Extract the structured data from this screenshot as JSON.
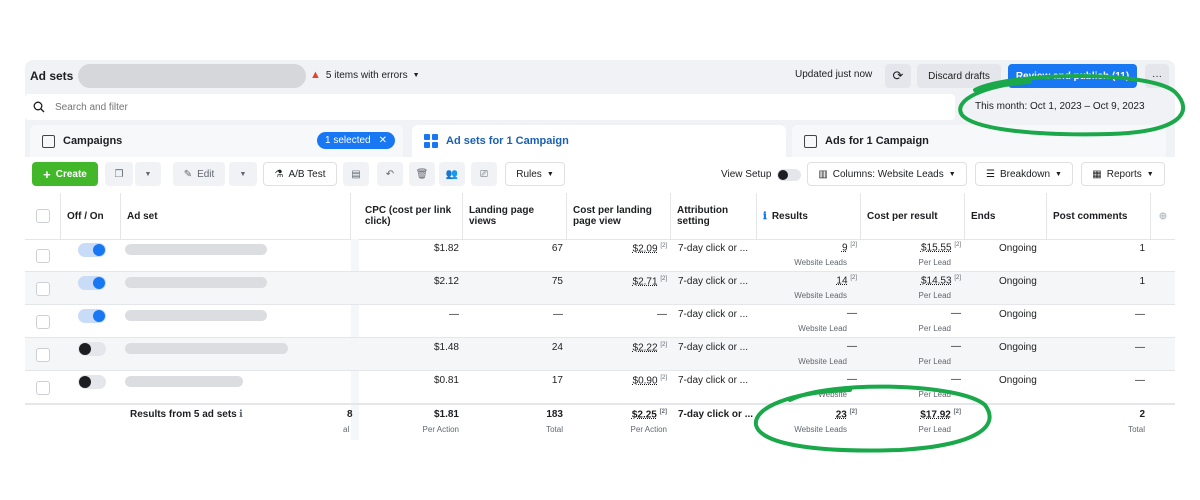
{
  "header": {
    "title": "Ad sets",
    "errors": "5 items with errors",
    "updated": "Updated just now",
    "discard": "Discard drafts",
    "publish": "Review and publish (11)",
    "more": "···"
  },
  "search": {
    "placeholder": "Search and filter"
  },
  "date_range": "This month: Oct 1, 2023 – Oct 9, 2023",
  "tabs": {
    "campaigns": "Campaigns",
    "selected": "1 selected",
    "adsets": "Ad sets for 1 Campaign",
    "ads": "Ads for 1 Campaign"
  },
  "toolbar": {
    "create": "Create",
    "edit": "Edit",
    "ab_test": "A/B Test",
    "rules": "Rules",
    "view_setup": "View Setup",
    "columns": "Columns: Website Leads",
    "breakdown": "Breakdown",
    "reports": "Reports"
  },
  "columns": {
    "off_on": "Off / On",
    "ad_set": "Ad set",
    "cpc": "CPC (cost per link click)",
    "lpv": "Landing page views",
    "cplpv": "Cost per landing page view",
    "attribution": "Attribution setting",
    "results": "Results",
    "cpr": "Cost per result",
    "ends": "Ends",
    "post_comments": "Post comments"
  },
  "rows": [
    {
      "on": true,
      "cpc": "$1.82",
      "lpv": "67",
      "cplpv": "$2.09",
      "attr": "7-day click or ...",
      "results": "9",
      "results_sub": "Website Leads",
      "cpr": "$15.55",
      "cpr_sub": "Per Lead",
      "ends": "Ongoing",
      "comments": "1"
    },
    {
      "on": true,
      "cpc": "$2.12",
      "lpv": "75",
      "cplpv": "$2.71",
      "attr": "7-day click or ...",
      "results": "14",
      "results_sub": "Website Leads",
      "cpr": "$14.53",
      "cpr_sub": "Per Lead",
      "ends": "Ongoing",
      "comments": "1"
    },
    {
      "on": true,
      "cpc": "—",
      "lpv": "—",
      "cplpv": "—",
      "attr": "7-day click or ...",
      "results": "—",
      "results_sub": "Website Lead",
      "cpr": "—",
      "cpr_sub": "Per Lead",
      "ends": "Ongoing",
      "comments": "—"
    },
    {
      "on": false,
      "cpc": "$1.48",
      "lpv": "24",
      "cplpv": "$2.22",
      "attr": "7-day click or ...",
      "results": "—",
      "results_sub": "Website Lead",
      "cpr": "—",
      "cpr_sub": "Per Lead",
      "ends": "Ongoing",
      "comments": "—"
    },
    {
      "on": false,
      "cpc": "$0.81",
      "lpv": "17",
      "cplpv": "$0.90",
      "attr": "7-day click or ...",
      "results": "—",
      "results_sub": "Website",
      "cpr": "—",
      "cpr_sub": "Per Lead",
      "ends": "Ongoing",
      "comments": "—"
    }
  ],
  "totals": {
    "label": "Results from 5 ad sets",
    "hidden_col": "8",
    "hidden_sub": "al",
    "cpc": "$1.81",
    "cpc_sub": "Per Action",
    "lpv": "183",
    "lpv_sub": "Total",
    "cplpv": "$2.25",
    "cplpv_sub": "Per Action",
    "attr": "7-day click or ...",
    "results": "23",
    "results_sub": "Website Leads",
    "cpr": "$17.92",
    "cpr_sub": "Per Lead",
    "comments": "2",
    "comments_sub": "Total"
  },
  "footnote_mark": "[2]",
  "colors": {
    "accent": "#1877f2",
    "create": "#42b72a",
    "annotation": "#1aa84a",
    "error": "#e0452d"
  }
}
